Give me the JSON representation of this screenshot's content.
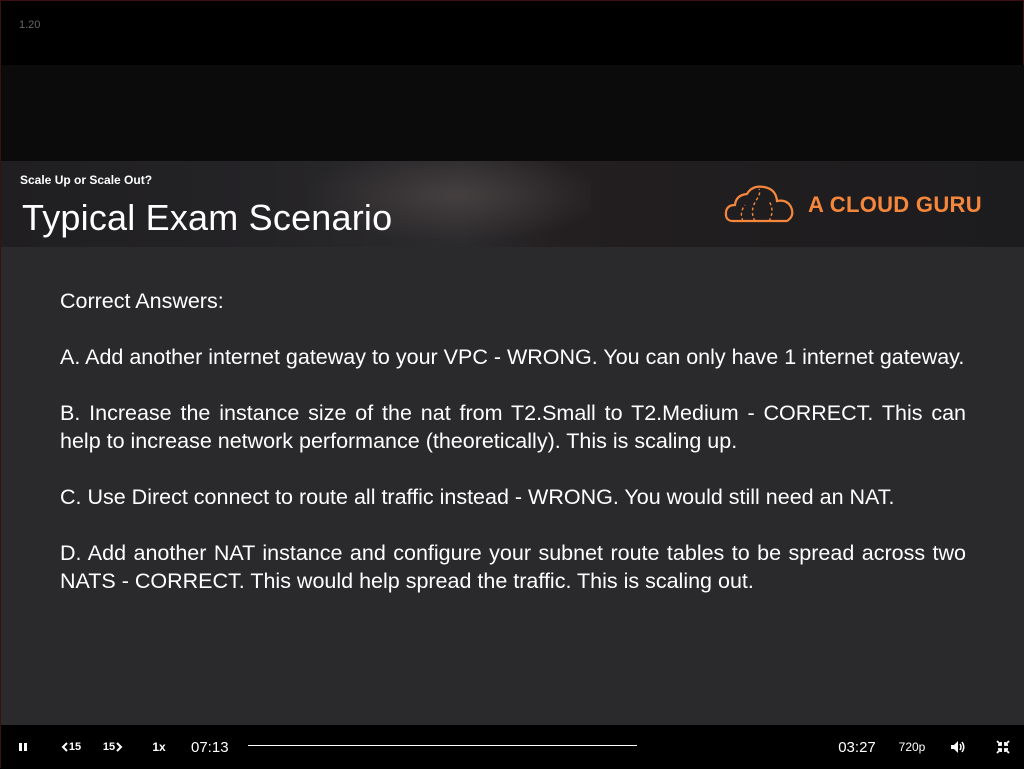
{
  "player": {
    "version_label": "1.20",
    "controls": {
      "current_time": "07:13",
      "remaining_time": "03:27",
      "speed_label": "1x",
      "back_label": "15",
      "forward_label": "15",
      "quality_label": "720p",
      "progress_fraction": 0.675,
      "icons": [
        "pause-icon",
        "rewind-15-icon",
        "forward-15-icon",
        "volume-icon",
        "exit-fullscreen-icon"
      ]
    }
  },
  "slide": {
    "subtitle": "Scale Up or Scale Out?",
    "title": "Typical Exam Scenario",
    "logo_text": "A CLOUD GURU",
    "brand_color": "#f5873c",
    "heading": "Correct Answers:",
    "answers": [
      "A. Add another internet gateway to your VPC - WRONG. You can only have 1 internet gateway.",
      "B. Increase the instance size of the nat from T2.Small to T2.Medium - CORRECT. This can help to increase network performance (theoretically). This is scaling up.",
      "C. Use Direct connect to route all traffic instead - WRONG. You would still need an NAT.",
      "D. Add another NAT instance and configure your subnet route tables to be spread across two NATS - CORRECT. This would help spread the traffic. This is scaling out."
    ]
  }
}
